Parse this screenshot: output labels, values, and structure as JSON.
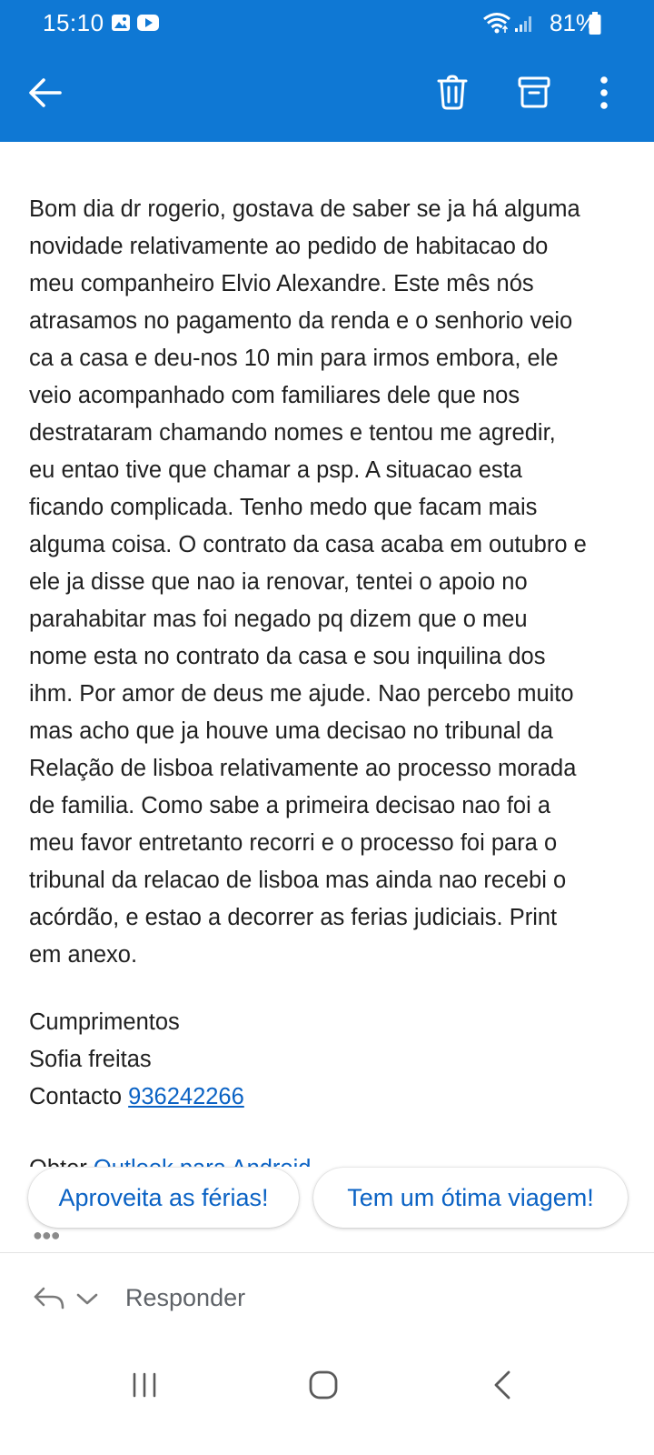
{
  "status_bar": {
    "time": "15:10",
    "battery_percent": "81%",
    "battery_level": 0.81,
    "notification_icons": [
      "gallery-icon",
      "youtube-icon"
    ],
    "system_icons": [
      "wifi-icon",
      "signal-icon",
      "battery-icon"
    ]
  },
  "toolbar": {
    "back_icon": "arrow-left-icon",
    "actions": [
      "trash-icon",
      "archive-icon",
      "more-vert-icon"
    ],
    "color": "#0f78d4"
  },
  "email": {
    "body": "Bom dia dr rogerio, gostava de saber se ja há alguma\nnovidade relativamente ao pedido de habitacao do\nmeu companheiro Elvio Alexandre. Este mês nós\natrasamos no pagamento da renda e o senhorio veio\nca a casa e deu-nos 10 min para irmos embora, ele\nveio acompanhado com familiares dele que nos\ndestrataram chamando nomes e tentou me agredir,\neu entao tive que chamar a psp. A situacao esta\nficando complicada. Tenho medo que facam mais\nalguma coisa. O contrato da casa acaba em outubro e\nele ja disse que nao ia renovar, tentei o apoio no\nparahabitar mas foi negado pq dizem que o meu\nnome esta no contrato da casa e sou inquilina dos\nihm. Por amor de deus me ajude. Nao percebo muito\nmas acho que ja houve uma decisao no tribunal da\nRelação de lisboa relativamente ao processo morada\nde familia. Como sabe a primeira decisao nao foi a\nmeu favor entretanto recorri e o processo foi para o\ntribunal da relacao de lisboa mas ainda nao recebi o\nacórdão, e estao a decorrer as ferias judiciais. Print\nem anexo.",
    "closing": "Cumprimentos",
    "sender_name": "Sofia freitas",
    "contact_label": "Contacto",
    "contact_phone": "936242266",
    "footer_prefix": "Obter",
    "footer_link": "Outlook para Android"
  },
  "smart_replies": [
    "Aproveita as férias!",
    "Tem um ótima viagem!"
  ],
  "reply_bar": {
    "reply_icon": "reply-icon",
    "dropdown_icon": "chevron-down-icon",
    "label": "Responder"
  },
  "nav_bar": {
    "buttons": [
      "recent-apps-icon",
      "home-icon",
      "back-icon"
    ]
  },
  "colors": {
    "accent": "#0f78d4",
    "link": "#0a62c4",
    "text": "#1f1f1f",
    "muted": "#5f6368"
  }
}
